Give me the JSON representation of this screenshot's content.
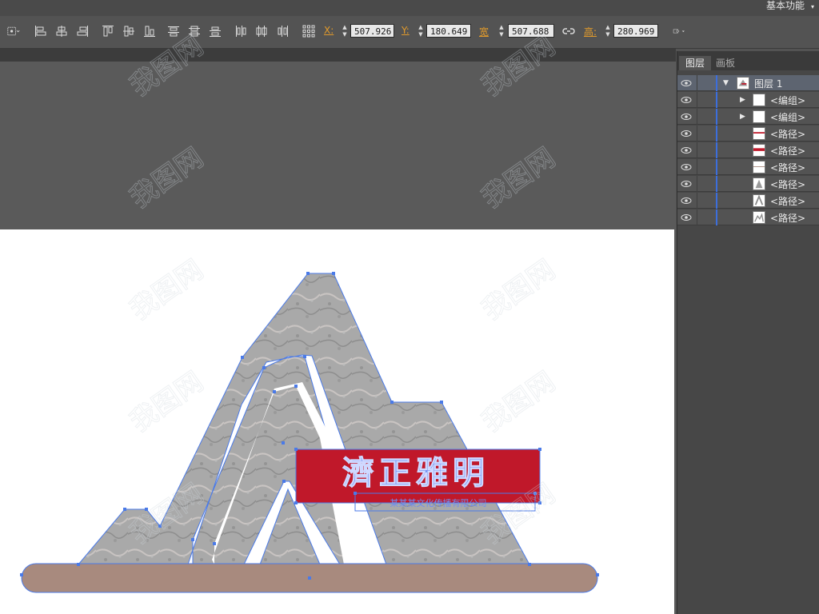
{
  "workspace": {
    "label": "基本功能",
    "arrow": "▾"
  },
  "control_bar": {
    "x_label": "X:",
    "x_value": "507.926",
    "y_label": "Y:",
    "y_value": "180.649",
    "width_label": "宽",
    "width_value": "507.688",
    "height_label": "高:",
    "height_value": "280.969"
  },
  "icons": {
    "reference_point": "reference-point-icon",
    "align": [
      "align-left-icon",
      "align-hcenter-icon",
      "align-right-icon",
      "align-top-icon",
      "align-vcenter-icon",
      "align-bottom-icon"
    ],
    "distribute": [
      "distribute-top-icon",
      "distribute-vcenter-icon",
      "distribute-bottom-icon",
      "distribute-left-icon",
      "distribute-hcenter-icon",
      "distribute-right-icon"
    ],
    "transform": "transform-grid-icon",
    "link": "constrain-proportions-icon",
    "envelope": "envelope-warp-icon"
  },
  "panel": {
    "tabs": [
      "图层",
      "画板"
    ],
    "layers": [
      {
        "name": "图层 1",
        "expanded": true,
        "thumb": "mountain"
      },
      {
        "name": "<编组>",
        "expandable": true,
        "thumb": "blank"
      },
      {
        "name": "<编组>",
        "expandable": true,
        "thumb": "blank"
      },
      {
        "name": "<路径>",
        "thumb": "red-line"
      },
      {
        "name": "<路径>",
        "thumb": "red-bar"
      },
      {
        "name": "<路径>",
        "thumb": "line"
      },
      {
        "name": "<路径>",
        "thumb": "grey-shape"
      },
      {
        "name": "<路径>",
        "thumb": "mountain-outline"
      },
      {
        "name": "<路径>",
        "thumb": "mountain-small"
      }
    ]
  },
  "artwork": {
    "title_text": "濟正雅明",
    "subtitle_text": "某某某文化传播有限公司",
    "colors": {
      "stone": "#a6a6a6",
      "banner": "#c0182a",
      "base": "#a88a7e",
      "selection": "#4a7ae8"
    }
  },
  "watermark": {
    "text": "我图网"
  }
}
